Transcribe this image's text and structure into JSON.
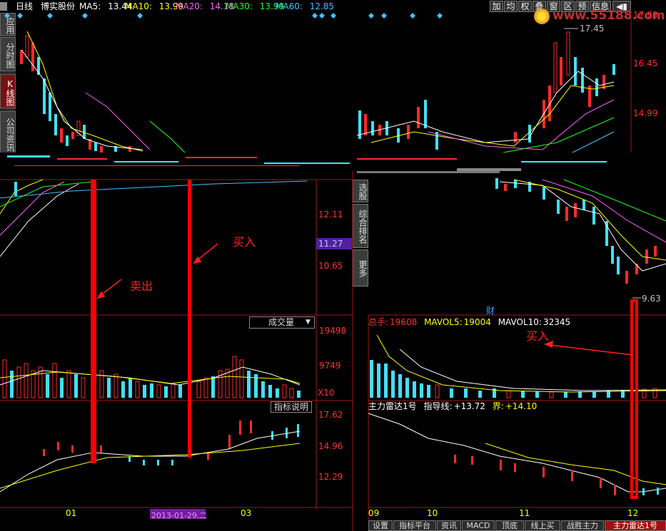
{
  "header": {
    "period": "日线",
    "stock_name": "博实股份",
    "ma": [
      {
        "label": "MA5:",
        "value": "13.44",
        "color": "#ffffff"
      },
      {
        "label": "MA10:",
        "value": "13.99",
        "color": "#ffff00"
      },
      {
        "label": "MA20:",
        "value": "14.18",
        "color": "#ff60ff"
      },
      {
        "label": "MA30:",
        "value": "13.99",
        "color": "#20ff20"
      },
      {
        "label": "MA60:",
        "value": "12.85",
        "color": "#40c0ff"
      }
    ]
  },
  "toolbar": {
    "buttons": [
      "加",
      "均",
      "权",
      "叠",
      "窗",
      "区",
      "预",
      "信息"
    ],
    "speaker": "◀▮"
  },
  "watermark": "www.55188.com",
  "left_nav": [
    "应用",
    "分时图",
    "K线图",
    "公司资讯"
  ],
  "mid_nav": [
    "选股",
    "综合排名",
    "更多"
  ],
  "left_chart": {
    "price_ticks": [
      "12.11",
      "10.65"
    ],
    "current_price": "11.27",
    "volume_dropdown": "成交量",
    "volume_ticks": [
      "19498",
      "9749"
    ],
    "volume_unit": "X10",
    "indicator_button": "指标说明",
    "indicator_ticks": [
      "17.62",
      "14.96",
      "12.29"
    ],
    "date_labels": [
      "01",
      "03"
    ],
    "date_cursor": "2013-01-29,二",
    "annotations": {
      "sell": "卖出",
      "buy": "买入"
    }
  },
  "right_chart": {
    "price_ticks": [
      "17.88",
      "16.45",
      "14.99"
    ],
    "high_label": "17.45",
    "low_label": "9.63",
    "cai_label": "财",
    "volume_legend": {
      "total_label": "总手:",
      "total_value": "19608",
      "mavol5_label": "MAVOL5:",
      "mavol5_value": "19004",
      "mavol10_label": "MAVOL10:",
      "mavol10_value": "32345"
    },
    "buy_label": "买入",
    "indicator_legend": {
      "name": "主力雷达1号",
      "guide_label": "指导线:",
      "guide_value": "+13.72",
      "bound_label": "界:",
      "bound_value": "+14.10"
    },
    "date_labels": [
      "09",
      "10",
      "11",
      "12"
    ]
  },
  "bottom_tabs": [
    "设置",
    "指标平台",
    "资讯",
    "MACD",
    "顶底",
    "线上买",
    "战胜主力",
    "主力雷达1号"
  ],
  "colors": {
    "up": "#ff2a2a",
    "down": "#40e0ff",
    "grid": "#a01818",
    "accent": "#ff0000"
  }
}
